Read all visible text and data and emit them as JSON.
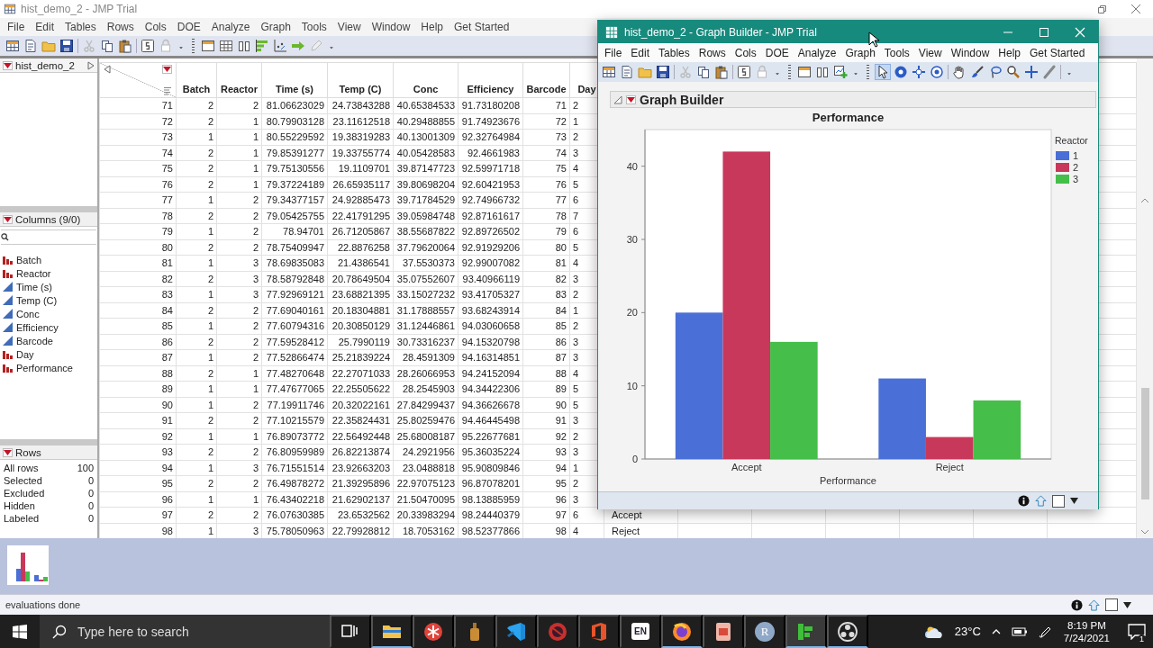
{
  "main_window": {
    "title": "hist_demo_2 - JMP Trial",
    "menu": [
      "File",
      "Edit",
      "Tables",
      "Rows",
      "Cols",
      "DOE",
      "Analyze",
      "Graph",
      "Tools",
      "View",
      "Window",
      "Help",
      "Get Started"
    ]
  },
  "table_panel": {
    "name": "hist_demo_2"
  },
  "columns_panel": {
    "title": "Columns (9/0)",
    "columns": [
      {
        "name": "Batch",
        "kind": "nominal"
      },
      {
        "name": "Reactor",
        "kind": "nominal"
      },
      {
        "name": "Time (s)",
        "kind": "continuous"
      },
      {
        "name": "Temp (C)",
        "kind": "continuous"
      },
      {
        "name": "Conc",
        "kind": "continuous"
      },
      {
        "name": "Efficiency",
        "kind": "continuous"
      },
      {
        "name": "Barcode",
        "kind": "continuous"
      },
      {
        "name": "Day",
        "kind": "nominal"
      },
      {
        "name": "Performance",
        "kind": "nominal"
      }
    ]
  },
  "rows_panel": {
    "title": "Rows",
    "stats": [
      {
        "label": "All rows",
        "value": "100"
      },
      {
        "label": "Selected",
        "value": "0"
      },
      {
        "label": "Excluded",
        "value": "0"
      },
      {
        "label": "Hidden",
        "value": "0"
      },
      {
        "label": "Labeled",
        "value": "0"
      }
    ]
  },
  "table": {
    "columns": [
      "",
      "Batch",
      "Reactor",
      "Time (s)",
      "Temp (C)",
      "Conc",
      "Efficiency",
      "Barcode",
      "Day"
    ],
    "rows": [
      {
        "cells": [
          "71",
          "2",
          "2",
          "81.06623029",
          "24.73843288",
          "40.65384533",
          "91.73180208",
          "71",
          "2"
        ]
      },
      {
        "cells": [
          "72",
          "2",
          "1",
          "80.79903128",
          "23.11612518",
          "40.29488855",
          "91.74923676",
          "72",
          "1"
        ]
      },
      {
        "cells": [
          "73",
          "1",
          "1",
          "80.55229592",
          "19.38319283",
          "40.13001309",
          "92.32764984",
          "73",
          "2"
        ]
      },
      {
        "cells": [
          "74",
          "2",
          "1",
          "79.85391277",
          "19.33755774",
          "40.05428583",
          "92.4661983",
          "74",
          "3"
        ]
      },
      {
        "cells": [
          "75",
          "2",
          "1",
          "79.75130556",
          "19.1109701",
          "39.87147723",
          "92.59971718",
          "75",
          "4"
        ]
      },
      {
        "cells": [
          "76",
          "2",
          "1",
          "79.37224189",
          "26.65935117",
          "39.80698204",
          "92.60421953",
          "76",
          "5"
        ]
      },
      {
        "cells": [
          "77",
          "1",
          "2",
          "79.34377157",
          "24.92885473",
          "39.71784529",
          "92.74966732",
          "77",
          "6"
        ]
      },
      {
        "cells": [
          "78",
          "2",
          "2",
          "79.05425755",
          "22.41791295",
          "39.05984748",
          "92.87161617",
          "78",
          "7"
        ]
      },
      {
        "cells": [
          "79",
          "1",
          "2",
          "78.94701",
          "26.71205867",
          "38.55687822",
          "92.89726502",
          "79",
          "6"
        ]
      },
      {
        "cells": [
          "80",
          "2",
          "2",
          "78.75409947",
          "22.8876258",
          "37.79620064",
          "92.91929206",
          "80",
          "5"
        ]
      },
      {
        "cells": [
          "81",
          "1",
          "3",
          "78.69835083",
          "21.4386541",
          "37.5530373",
          "92.99007082",
          "81",
          "4"
        ]
      },
      {
        "cells": [
          "82",
          "2",
          "3",
          "78.58792848",
          "20.78649504",
          "35.07552607",
          "93.40966119",
          "82",
          "3"
        ]
      },
      {
        "cells": [
          "83",
          "1",
          "3",
          "77.92969121",
          "23.68821395",
          "33.15027232",
          "93.41705327",
          "83",
          "2"
        ]
      },
      {
        "cells": [
          "84",
          "2",
          "2",
          "77.69040161",
          "20.18304881",
          "31.17888557",
          "93.68243914",
          "84",
          "1"
        ]
      },
      {
        "cells": [
          "85",
          "1",
          "2",
          "77.60794316",
          "20.30850129",
          "31.12446861",
          "94.03060658",
          "85",
          "2"
        ]
      },
      {
        "cells": [
          "86",
          "2",
          "2",
          "77.59528412",
          "25.7990119",
          "30.73316237",
          "94.15320798",
          "86",
          "3"
        ]
      },
      {
        "cells": [
          "87",
          "1",
          "2",
          "77.52866474",
          "25.21839224",
          "28.4591309",
          "94.16314851",
          "87",
          "3"
        ]
      },
      {
        "cells": [
          "88",
          "2",
          "1",
          "77.48270648",
          "22.27071033",
          "28.26066953",
          "94.24152094",
          "88",
          "4"
        ]
      },
      {
        "cells": [
          "89",
          "1",
          "1",
          "77.47677065",
          "22.25505622",
          "28.2545903",
          "94.34422306",
          "89",
          "5"
        ]
      },
      {
        "cells": [
          "90",
          "1",
          "2",
          "77.19911746",
          "20.32022161",
          "27.84299437",
          "94.36626678",
          "90",
          "5"
        ]
      },
      {
        "cells": [
          "91",
          "2",
          "2",
          "77.10215579",
          "22.35824431",
          "25.80259476",
          "94.46445498",
          "91",
          "3"
        ]
      },
      {
        "cells": [
          "92",
          "1",
          "1",
          "76.89073772",
          "22.56492448",
          "25.68008187",
          "95.22677681",
          "92",
          "2"
        ]
      },
      {
        "cells": [
          "93",
          "2",
          "2",
          "76.80959989",
          "26.82213874",
          "24.2921956",
          "95.36035224",
          "93",
          "3"
        ]
      },
      {
        "cells": [
          "94",
          "1",
          "3",
          "76.71551514",
          "23.92663203",
          "23.0488818",
          "95.90809846",
          "94",
          "1"
        ]
      },
      {
        "cells": [
          "95",
          "2",
          "2",
          "76.49878272",
          "21.39295896",
          "22.97075123",
          "96.87078201",
          "95",
          "2"
        ]
      },
      {
        "cells": [
          "96",
          "1",
          "1",
          "76.43402218",
          "21.62902137",
          "21.50470095",
          "98.13885959",
          "96",
          "3"
        ]
      },
      {
        "cells": [
          "97",
          "2",
          "2",
          "76.07630385",
          "23.6532562",
          "20.33983294",
          "98.24440379",
          "97",
          "6",
          "Accept"
        ]
      },
      {
        "cells": [
          "98",
          "1",
          "3",
          "75.78050963",
          "22.79928812",
          "18.7053162",
          "98.52377866",
          "98",
          "4",
          "Reject"
        ]
      }
    ]
  },
  "graph_window": {
    "title": "hist_demo_2 - Graph Builder - JMP Trial",
    "menu": [
      "File",
      "Edit",
      "Tables",
      "Rows",
      "Cols",
      "DOE",
      "Analyze",
      "Graph",
      "Tools",
      "View",
      "Window",
      "Help",
      "Get Started"
    ],
    "tools": [
      {
        "kind": "pointer",
        "selected": true
      },
      {
        "kind": "help",
        "selected": false
      },
      {
        "kind": "crosshair",
        "selected": false
      },
      {
        "kind": "target",
        "selected": false
      },
      {
        "kind": "hand",
        "selected": false
      },
      {
        "kind": "brush",
        "selected": false
      },
      {
        "kind": "lasso",
        "selected": false
      },
      {
        "kind": "magnifier",
        "selected": false
      },
      {
        "kind": "plus",
        "selected": false
      },
      {
        "kind": "line",
        "selected": false
      }
    ],
    "section_title": "Graph Builder",
    "chart_data": {
      "type": "bar",
      "title": "Performance",
      "legend": {
        "title": "Reactor"
      },
      "xlabel": "Performance",
      "categories": [
        "Accept",
        "Reject"
      ],
      "series": [
        {
          "name": "1",
          "color": "#4a6fd6",
          "values": [
            20,
            11
          ]
        },
        {
          "name": "2",
          "color": "#c8385a",
          "values": [
            42,
            3
          ]
        },
        {
          "name": "3",
          "color": "#45be4a",
          "values": [
            16,
            8
          ]
        }
      ],
      "ylim": [
        0,
        45
      ],
      "yticks": [
        0,
        10,
        20,
        30,
        40
      ]
    }
  },
  "status_bar": {
    "text": "evaluations done"
  },
  "taskbar": {
    "search_placeholder": "Type here to search",
    "apps": [
      {
        "kind": "task-view",
        "running": false,
        "selected": false
      },
      {
        "kind": "folder",
        "running": true,
        "selected": false
      },
      {
        "kind": "asterisk",
        "running": false,
        "selected": false
      },
      {
        "kind": "bottle",
        "running": false,
        "selected": false
      },
      {
        "kind": "ribbon",
        "running": false,
        "selected": false
      },
      {
        "kind": "red-circle",
        "running": false,
        "selected": false
      },
      {
        "kind": "office",
        "running": false,
        "selected": false
      },
      {
        "kind": "language",
        "label": "EN",
        "running": false,
        "selected": false
      },
      {
        "kind": "browser",
        "running": true,
        "selected": false
      },
      {
        "kind": "document",
        "running": false,
        "selected": false
      },
      {
        "kind": "r",
        "label": "R",
        "running": false,
        "selected": false
      },
      {
        "kind": "bars",
        "running": true,
        "selected": true
      },
      {
        "kind": "obs",
        "running": true,
        "selected": false
      }
    ],
    "temperature": "23°C",
    "time": "8:19 PM",
    "date": "7/24/2021",
    "notification_count": "1"
  }
}
